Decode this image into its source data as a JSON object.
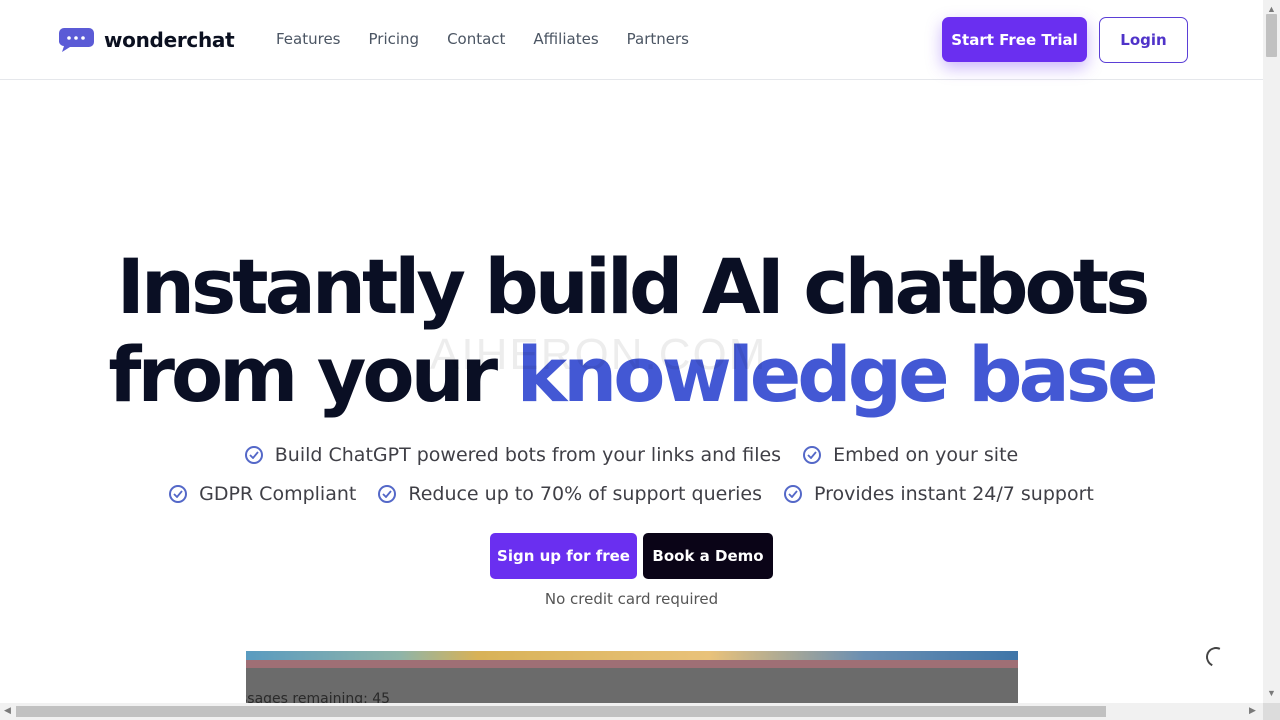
{
  "brand": {
    "name": "wonderchat",
    "accent": "#6a2ff0",
    "headline_accent": "#4358d4"
  },
  "nav": {
    "items": [
      "Features",
      "Pricing",
      "Contact",
      "Affiliates",
      "Partners"
    ]
  },
  "header": {
    "trial_label": "Start Free Trial",
    "login_label": "Login"
  },
  "hero": {
    "line1": "Instantly build AI chatbots",
    "line2_plain": "from your ",
    "line2_accent": "knowledge base",
    "watermark": "AIHERON.COM",
    "features_row1": [
      "Build ChatGPT powered bots from your links and files",
      "Embed on your site"
    ],
    "features_row2": [
      "GDPR Compliant",
      "Reduce up to 70% of support queries",
      "Provides instant 24/7 support"
    ],
    "signup_label": "Sign up for free",
    "demo_label": "Book a Demo",
    "note": "No credit card required"
  },
  "preview": {
    "text": "ssages remaining: 45"
  },
  "icons": {
    "check": "check-circle-icon",
    "logo": "chat-bubble-icon",
    "loading": "spinner-icon"
  }
}
